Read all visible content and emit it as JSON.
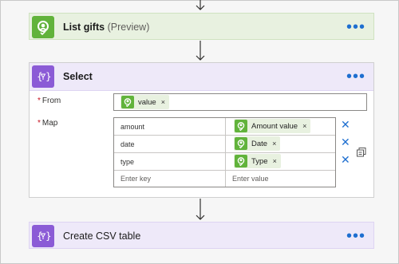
{
  "colors": {
    "connector_green": "#61b33b",
    "data_ops_purple": "#8b5bd6",
    "accent_blue": "#1e6fd0",
    "required_red": "#c50f1f"
  },
  "gift_card": {
    "title": "List gifts",
    "subtitle": "(Preview)",
    "icon": "person-check-icon",
    "menu": "•••"
  },
  "select_card": {
    "title": "Select",
    "icon": "data-operation-icon",
    "menu": "•••",
    "from_label": "From",
    "map_label": "Map",
    "required_mark": "*",
    "from_token": {
      "label": "value",
      "remove": "×"
    },
    "map_rows": [
      {
        "key": "amount",
        "value_token": "Amount value",
        "remove": "×",
        "delete": "✕"
      },
      {
        "key": "date",
        "value_token": "Date",
        "remove": "×",
        "delete": "✕"
      },
      {
        "key": "type",
        "value_token": "Type",
        "remove": "×",
        "delete": "✕"
      }
    ],
    "key_placeholder": "Enter key",
    "value_placeholder": "Enter value"
  },
  "csv_card": {
    "title": "Create CSV table",
    "icon": "data-operation-icon",
    "menu": "•••"
  }
}
